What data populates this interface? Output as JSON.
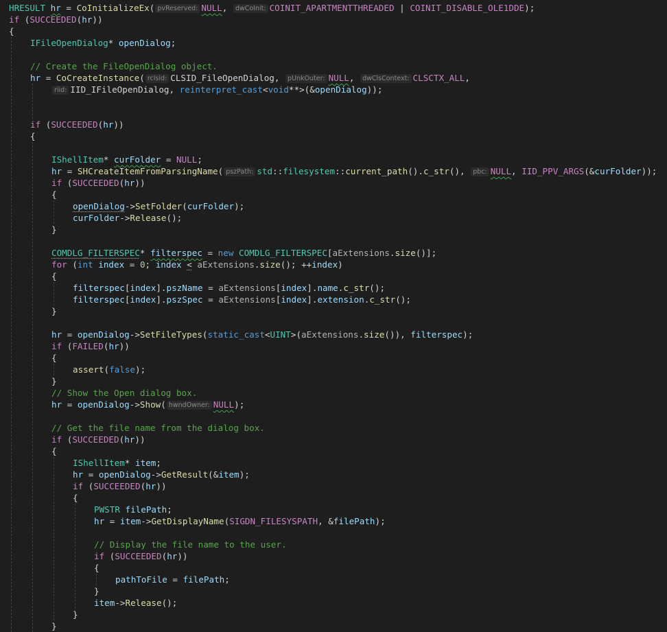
{
  "theme": {
    "background": "#1e1e1e",
    "colors": {
      "t": "#4ec9b0",
      "v": "#9cdcfe",
      "f": "#dcdcaa",
      "m": "#c586c0",
      "k": "#569cd6",
      "c": "#57a64a",
      "n": "#b5cea8",
      "p": "#d4d4d4",
      "s": "#ce9178",
      "o": "#b4b4b4"
    }
  },
  "code_lines": [
    {
      "indent": 0,
      "tokens": [
        [
          "t",
          "HRESULT"
        ],
        [
          "p",
          " "
        ],
        [
          "v",
          "hr",
          1
        ],
        [
          "p",
          " = "
        ],
        [
          "f",
          "CoInitializeEx"
        ],
        [
          "p",
          "("
        ],
        [
          "h",
          "pvReserved:"
        ],
        [
          "m",
          "NULL",
          1
        ],
        [
          "p",
          ", "
        ],
        [
          "h",
          "dwCoInit:"
        ],
        [
          "m",
          "COINIT_APARTMENTTHREADED"
        ],
        [
          "p",
          " | "
        ],
        [
          "m",
          "COINIT_DISABLE_OLE1DDE"
        ],
        [
          "p",
          ");"
        ]
      ]
    },
    {
      "indent": 0,
      "tokens": [
        [
          "m",
          "if"
        ],
        [
          "p",
          " ("
        ],
        [
          "m",
          "SUCCEEDED"
        ],
        [
          "p",
          "("
        ],
        [
          "v",
          "hr"
        ],
        [
          "p",
          "))"
        ]
      ]
    },
    {
      "indent": 0,
      "tokens": [
        [
          "p",
          "{"
        ]
      ]
    },
    {
      "indent": 1,
      "tokens": [
        [
          "t",
          "IFileOpenDialog"
        ],
        [
          "p",
          "* "
        ],
        [
          "v",
          "openDialog"
        ],
        [
          "p",
          ";"
        ]
      ]
    },
    {
      "indent": 0,
      "tokens": []
    },
    {
      "indent": 1,
      "tokens": [
        [
          "c",
          "// Create the FileOpenDialog object."
        ]
      ]
    },
    {
      "indent": 1,
      "tokens": [
        [
          "v",
          "hr"
        ],
        [
          "p",
          " = "
        ],
        [
          "f",
          "CoCreateInstance"
        ],
        [
          "p",
          "("
        ],
        [
          "h",
          "rclsid:"
        ],
        [
          "p",
          "CLSID_FileOpenDialog, "
        ],
        [
          "h",
          "pUnkOuter:"
        ],
        [
          "m",
          "NULL",
          1
        ],
        [
          "p",
          ", "
        ],
        [
          "h",
          "dwClsContext:"
        ],
        [
          "m",
          "CLSCTX_ALL"
        ],
        [
          "p",
          ","
        ]
      ]
    },
    {
      "indent": 2,
      "tokens": [
        [
          "h",
          "riid:"
        ],
        [
          "p",
          "IID_IFileOpenDialog, "
        ],
        [
          "k",
          "reinterpret_cast"
        ],
        [
          "p",
          "<"
        ],
        [
          "k",
          "void"
        ],
        [
          "p",
          "**>(&"
        ],
        [
          "v",
          "openDialog"
        ],
        [
          "p",
          "));"
        ]
      ]
    },
    {
      "indent": 0,
      "tokens": []
    },
    {
      "indent": 0,
      "tokens": []
    },
    {
      "indent": 1,
      "tokens": [
        [
          "m",
          "if"
        ],
        [
          "p",
          " ("
        ],
        [
          "m",
          "SUCCEEDED"
        ],
        [
          "p",
          "("
        ],
        [
          "v",
          "hr"
        ],
        [
          "p",
          "))"
        ]
      ]
    },
    {
      "indent": 1,
      "tokens": [
        [
          "p",
          "{"
        ]
      ]
    },
    {
      "indent": 0,
      "tokens": []
    },
    {
      "indent": 2,
      "tokens": [
        [
          "t",
          "IShellItem"
        ],
        [
          "p",
          "* "
        ],
        [
          "v",
          "curFolder",
          1
        ],
        [
          "p",
          " = "
        ],
        [
          "m",
          "NULL"
        ],
        [
          "p",
          ";"
        ]
      ]
    },
    {
      "indent": 2,
      "tokens": [
        [
          "v",
          "hr"
        ],
        [
          "p",
          " = "
        ],
        [
          "f",
          "SHCreateItemFromParsingName"
        ],
        [
          "p",
          "("
        ],
        [
          "h",
          "pszPath:"
        ],
        [
          "t",
          "std"
        ],
        [
          "p",
          "::"
        ],
        [
          "t",
          "filesystem"
        ],
        [
          "p",
          "::"
        ],
        [
          "f",
          "current_path"
        ],
        [
          "p",
          "()."
        ],
        [
          "f",
          "c_str"
        ],
        [
          "p",
          "(), "
        ],
        [
          "h",
          "pbc:"
        ],
        [
          "m",
          "NULL",
          1
        ],
        [
          "p",
          ", "
        ],
        [
          "m",
          "IID_PPV_ARGS"
        ],
        [
          "p",
          "(&"
        ],
        [
          "v",
          "curFolder"
        ],
        [
          "p",
          "));"
        ]
      ]
    },
    {
      "indent": 2,
      "tokens": [
        [
          "m",
          "if"
        ],
        [
          "p",
          " ("
        ],
        [
          "m",
          "SUCCEEDED"
        ],
        [
          "p",
          "("
        ],
        [
          "v",
          "hr"
        ],
        [
          "p",
          "))"
        ]
      ]
    },
    {
      "indent": 2,
      "tokens": [
        [
          "p",
          "{"
        ]
      ]
    },
    {
      "indent": 3,
      "tokens": [
        [
          "v",
          "openDialog",
          2
        ],
        [
          "p",
          "->"
        ],
        [
          "f",
          "SetFolder"
        ],
        [
          "p",
          "("
        ],
        [
          "v",
          "curFolder"
        ],
        [
          "p",
          ");"
        ]
      ]
    },
    {
      "indent": 3,
      "tokens": [
        [
          "v",
          "curFolder"
        ],
        [
          "p",
          "->"
        ],
        [
          "f",
          "Release"
        ],
        [
          "p",
          "();"
        ]
      ]
    },
    {
      "indent": 2,
      "tokens": [
        [
          "p",
          "}"
        ]
      ]
    },
    {
      "indent": 0,
      "tokens": []
    },
    {
      "indent": 2,
      "tokens": [
        [
          "t",
          "COMDLG_FILTERSPEC",
          2
        ],
        [
          "p",
          "* "
        ],
        [
          "v",
          "filterspec",
          1
        ],
        [
          "p",
          " = "
        ],
        [
          "k",
          "new"
        ],
        [
          "p",
          " "
        ],
        [
          "t",
          "COMDLG_FILTERSPEC"
        ],
        [
          "p",
          "["
        ],
        [
          "o",
          "aExtensions"
        ],
        [
          "p",
          "."
        ],
        [
          "f",
          "size"
        ],
        [
          "p",
          "()];"
        ]
      ]
    },
    {
      "indent": 2,
      "tokens": [
        [
          "m",
          "for"
        ],
        [
          "p",
          " ("
        ],
        [
          "k",
          "int"
        ],
        [
          "p",
          " "
        ],
        [
          "v",
          "index"
        ],
        [
          "p",
          " = "
        ],
        [
          "n",
          "0"
        ],
        [
          "p",
          "; "
        ],
        [
          "v",
          "index"
        ],
        [
          "p",
          " "
        ],
        [
          "p",
          "<",
          2
        ],
        [
          "p",
          " "
        ],
        [
          "o",
          "aExtensions"
        ],
        [
          "p",
          "."
        ],
        [
          "f",
          "size"
        ],
        [
          "p",
          "(); ++"
        ],
        [
          "v",
          "index"
        ],
        [
          "p",
          ")"
        ]
      ]
    },
    {
      "indent": 2,
      "tokens": [
        [
          "p",
          "{"
        ]
      ]
    },
    {
      "indent": 3,
      "tokens": [
        [
          "v",
          "filterspec"
        ],
        [
          "p",
          "["
        ],
        [
          "v",
          "index"
        ],
        [
          "p",
          "]."
        ],
        [
          "v",
          "pszName"
        ],
        [
          "p",
          " = "
        ],
        [
          "o",
          "aExtensions"
        ],
        [
          "p",
          "["
        ],
        [
          "v",
          "index"
        ],
        [
          "p",
          "]."
        ],
        [
          "v",
          "name"
        ],
        [
          "p",
          "."
        ],
        [
          "f",
          "c_str"
        ],
        [
          "p",
          "();"
        ]
      ]
    },
    {
      "indent": 3,
      "tokens": [
        [
          "v",
          "filterspec"
        ],
        [
          "p",
          "["
        ],
        [
          "v",
          "index"
        ],
        [
          "p",
          "]."
        ],
        [
          "v",
          "pszSpec"
        ],
        [
          "p",
          " = "
        ],
        [
          "o",
          "aExtensions"
        ],
        [
          "p",
          "["
        ],
        [
          "v",
          "index"
        ],
        [
          "p",
          "]."
        ],
        [
          "v",
          "extension"
        ],
        [
          "p",
          "."
        ],
        [
          "f",
          "c_str"
        ],
        [
          "p",
          "();"
        ]
      ]
    },
    {
      "indent": 2,
      "tokens": [
        [
          "p",
          "}"
        ]
      ]
    },
    {
      "indent": 0,
      "tokens": []
    },
    {
      "indent": 2,
      "tokens": [
        [
          "v",
          "hr"
        ],
        [
          "p",
          " = "
        ],
        [
          "v",
          "openDialog"
        ],
        [
          "p",
          "->"
        ],
        [
          "f",
          "SetFileTypes"
        ],
        [
          "p",
          "("
        ],
        [
          "k",
          "static_cast"
        ],
        [
          "p",
          "<"
        ],
        [
          "t",
          "UINT"
        ],
        [
          "p",
          ">("
        ],
        [
          "o",
          "aExtensions"
        ],
        [
          "p",
          "."
        ],
        [
          "f",
          "size"
        ],
        [
          "p",
          "()), "
        ],
        [
          "v",
          "filterspec"
        ],
        [
          "p",
          ");"
        ]
      ]
    },
    {
      "indent": 2,
      "tokens": [
        [
          "m",
          "if"
        ],
        [
          "p",
          " ("
        ],
        [
          "m",
          "FAILED"
        ],
        [
          "p",
          "("
        ],
        [
          "v",
          "hr"
        ],
        [
          "p",
          "))"
        ]
      ]
    },
    {
      "indent": 2,
      "tokens": [
        [
          "p",
          "{"
        ]
      ]
    },
    {
      "indent": 3,
      "tokens": [
        [
          "f",
          "assert"
        ],
        [
          "p",
          "("
        ],
        [
          "k",
          "false"
        ],
        [
          "p",
          ");"
        ]
      ]
    },
    {
      "indent": 2,
      "tokens": [
        [
          "p",
          "}"
        ]
      ]
    },
    {
      "indent": 2,
      "tokens": [
        [
          "c",
          "// Show the Open dialog box."
        ]
      ]
    },
    {
      "indent": 2,
      "tokens": [
        [
          "v",
          "hr"
        ],
        [
          "p",
          " = "
        ],
        [
          "v",
          "openDialog"
        ],
        [
          "p",
          "->"
        ],
        [
          "f",
          "Show"
        ],
        [
          "p",
          "("
        ],
        [
          "h",
          "hwndOwner:"
        ],
        [
          "m",
          "NULL",
          1
        ],
        [
          "p",
          ");"
        ]
      ]
    },
    {
      "indent": 0,
      "tokens": []
    },
    {
      "indent": 2,
      "tokens": [
        [
          "c",
          "// Get the file name from the dialog box."
        ]
      ]
    },
    {
      "indent": 2,
      "tokens": [
        [
          "m",
          "if"
        ],
        [
          "p",
          " ("
        ],
        [
          "m",
          "SUCCEEDED"
        ],
        [
          "p",
          "("
        ],
        [
          "v",
          "hr"
        ],
        [
          "p",
          "))"
        ]
      ]
    },
    {
      "indent": 2,
      "tokens": [
        [
          "p",
          "{"
        ]
      ]
    },
    {
      "indent": 3,
      "tokens": [
        [
          "t",
          "IShellItem"
        ],
        [
          "p",
          "* "
        ],
        [
          "v",
          "item"
        ],
        [
          "p",
          ";"
        ]
      ]
    },
    {
      "indent": 3,
      "tokens": [
        [
          "v",
          "hr"
        ],
        [
          "p",
          " = "
        ],
        [
          "v",
          "openDialog"
        ],
        [
          "p",
          "->"
        ],
        [
          "f",
          "GetResult"
        ],
        [
          "p",
          "(&"
        ],
        [
          "v",
          "item"
        ],
        [
          "p",
          ");"
        ]
      ]
    },
    {
      "indent": 3,
      "tokens": [
        [
          "m",
          "if"
        ],
        [
          "p",
          " ("
        ],
        [
          "m",
          "SUCCEEDED"
        ],
        [
          "p",
          "("
        ],
        [
          "v",
          "hr"
        ],
        [
          "p",
          "))"
        ]
      ]
    },
    {
      "indent": 3,
      "tokens": [
        [
          "p",
          "{"
        ]
      ]
    },
    {
      "indent": 4,
      "tokens": [
        [
          "t",
          "PWSTR"
        ],
        [
          "p",
          " "
        ],
        [
          "v",
          "filePath"
        ],
        [
          "p",
          ";"
        ]
      ]
    },
    {
      "indent": 4,
      "tokens": [
        [
          "v",
          "hr"
        ],
        [
          "p",
          " = "
        ],
        [
          "v",
          "item"
        ],
        [
          "p",
          "->"
        ],
        [
          "f",
          "GetDisplayName"
        ],
        [
          "p",
          "("
        ],
        [
          "m",
          "SIGDN_FILESYSPATH"
        ],
        [
          "p",
          ", &"
        ],
        [
          "v",
          "filePath"
        ],
        [
          "p",
          ");"
        ]
      ]
    },
    {
      "indent": 0,
      "tokens": []
    },
    {
      "indent": 4,
      "tokens": [
        [
          "c",
          "// Display the file name to the user."
        ]
      ]
    },
    {
      "indent": 4,
      "tokens": [
        [
          "m",
          "if"
        ],
        [
          "p",
          " ("
        ],
        [
          "m",
          "SUCCEEDED"
        ],
        [
          "p",
          "("
        ],
        [
          "v",
          "hr"
        ],
        [
          "p",
          "))"
        ]
      ]
    },
    {
      "indent": 4,
      "tokens": [
        [
          "p",
          "{"
        ]
      ]
    },
    {
      "indent": 5,
      "tokens": [
        [
          "v",
          "pathToFile"
        ],
        [
          "p",
          " = "
        ],
        [
          "v",
          "filePath"
        ],
        [
          "p",
          ";"
        ]
      ]
    },
    {
      "indent": 4,
      "tokens": [
        [
          "p",
          "}"
        ]
      ]
    },
    {
      "indent": 4,
      "tokens": [
        [
          "v",
          "item"
        ],
        [
          "p",
          "->"
        ],
        [
          "f",
          "Release"
        ],
        [
          "p",
          "();"
        ]
      ]
    },
    {
      "indent": 3,
      "tokens": [
        [
          "p",
          "}"
        ]
      ]
    },
    {
      "indent": 2,
      "tokens": [
        [
          "p",
          "}"
        ]
      ]
    }
  ]
}
